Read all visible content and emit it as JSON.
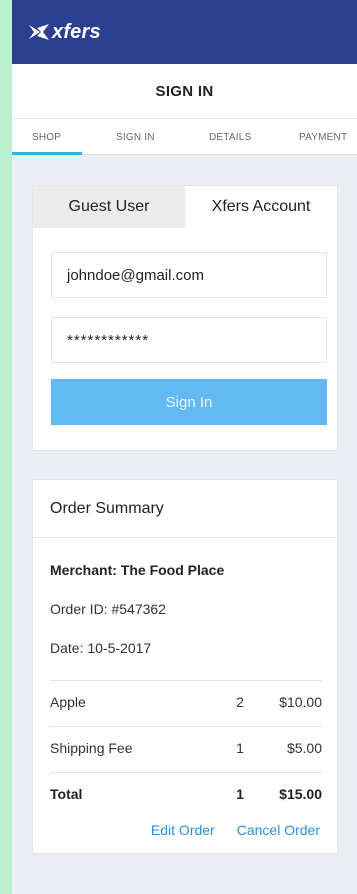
{
  "brand": {
    "name": "xfers"
  },
  "header": {
    "title": "SIGN IN"
  },
  "steps": [
    "SHOP",
    "SIGN IN",
    "DETAILS",
    "PAYMENT"
  ],
  "signin": {
    "tabs": {
      "guest": "Guest User",
      "account": "Xfers Account"
    },
    "email_value": "johndoe@gmail.com",
    "password_value": "************",
    "button_label": "Sign In"
  },
  "order": {
    "title": "Order Summary",
    "merchant": "Merchant: The Food Place",
    "order_id": "Order ID: #547362",
    "date": "Date: 10-5-2017",
    "items": [
      {
        "name": "Apple",
        "qty": "2",
        "amount": "$10.00"
      },
      {
        "name": "Shipping Fee",
        "qty": "1",
        "amount": "$5.00"
      }
    ],
    "total": {
      "label": "Total",
      "qty": "1",
      "amount": "$15.00"
    },
    "edit_label": "Edit Order",
    "cancel_label": "Cancel Order"
  },
  "colors": {
    "topbar": "#2c3e8f",
    "accent_underline": "#2fb3e6",
    "button": "#62b9f3",
    "link": "#2d8fd6"
  }
}
